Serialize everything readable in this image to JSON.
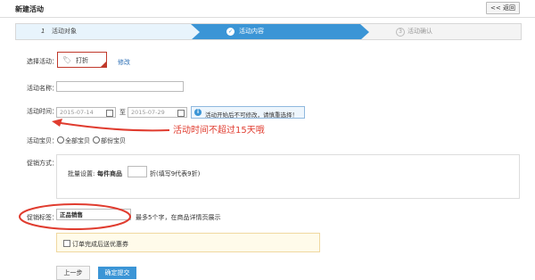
{
  "header": {
    "title": "新建活动",
    "back_label": "<< 返回"
  },
  "steps": [
    {
      "num": "1",
      "label": "活动对象"
    },
    {
      "num": "✓",
      "label": "活动内容"
    },
    {
      "num": "3",
      "label": "活动确认"
    }
  ],
  "form": {
    "type_label": "选择活动：",
    "type_value": "打折",
    "modify_link": "修改",
    "name_label": "活动名称：",
    "name_value": "",
    "time_label": "活动时间：",
    "start_date": "2015-07-14",
    "to_text": "至",
    "end_date": "2015-07-29",
    "time_notice": "活动开始后不可修改，请慎重选择！",
    "items_label": "活动宝贝：",
    "radio_all": "全部宝贝",
    "radio_part": "部份宝贝",
    "promo_label": "促销方式：",
    "batch_label": "批量设置:",
    "per_item": "每件商品",
    "discount_value": "",
    "discount_hint": "折(填写9代表9折)",
    "tag_label": "促销标签：",
    "tag_value": "正品销售",
    "tag_hint": "最多5个字，在商品详情页展示",
    "coupon_label": "订单完成后送优惠券",
    "prev_label": "上一步",
    "submit_label": "确定提交"
  },
  "annotation": {
    "text": "活动时间不超过15天哦"
  },
  "colors": {
    "accent": "#3b95d6",
    "annotation": "#e03c2f"
  }
}
